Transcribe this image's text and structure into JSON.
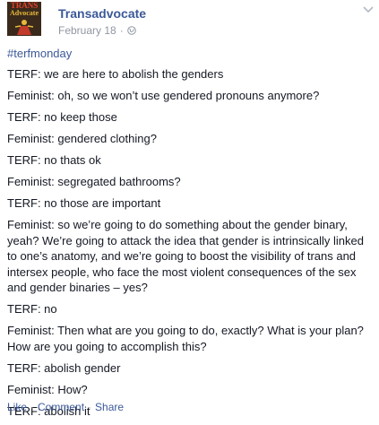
{
  "post": {
    "author": "Transadvocate",
    "avatar_text_top": "TRANS",
    "avatar_text_bottom": "Advocate",
    "date": "February 18",
    "separator": "·",
    "hashtag": "#terfmonday",
    "paragraphs": [
      "TERF: we are here to abolish the genders",
      "Feminist: oh, so we won’t use gendered pronouns anymore?",
      "TERF: no keep those",
      "Feminist: gendered clothing?",
      "TERF: no thats ok",
      "Feminist: segregated bathrooms?",
      "TERF: no those are important",
      "Feminist: so we’re going to do something about the gender binary, yeah? We’re going to attack the idea that gender is intrinsically linked to one’s anatomy, and we’re going to boost the visibility of trans and intersex people, who face the most violent consequences of the sex and gender binaries – yes?",
      "TERF: no",
      "Feminist: Then what are you going to do, exactly? What is your plan? How are you going to accomplish this?",
      "TERF: abolish gender",
      "Feminist: How?",
      "TERF: abolish it"
    ]
  },
  "actions": {
    "like": "Like",
    "comment": "Comment",
    "share": "Share",
    "separator": "·"
  },
  "icons": {
    "privacy": "globe-icon",
    "menu": "chevron-down-icon"
  },
  "colors": {
    "link": "#3b5998",
    "meta": "#9197a3",
    "text": "#141823"
  }
}
